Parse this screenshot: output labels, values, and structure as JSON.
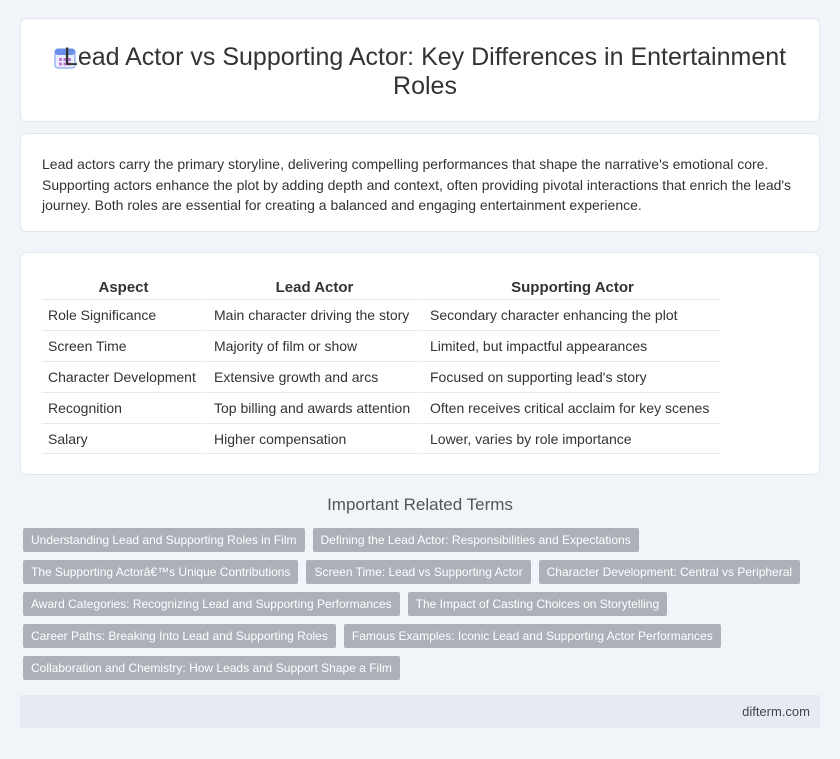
{
  "header": {
    "title": "Lead Actor vs Supporting Actor: Key Differences in Entertainment Roles",
    "icon": "calendar-icon"
  },
  "intro": {
    "text": "Lead actors carry the primary storyline, delivering compelling performances that shape the narrative's emotional core. Supporting actors enhance the plot by adding depth and context, often providing pivotal interactions that enrich the lead's journey. Both roles are essential for creating a balanced and engaging entertainment experience."
  },
  "table": {
    "headers": [
      "Aspect",
      "Lead Actor",
      "Supporting Actor"
    ],
    "rows": [
      [
        "Role Significance",
        "Main character driving the story",
        "Secondary character enhancing the plot"
      ],
      [
        "Screen Time",
        "Majority of film or show",
        "Limited, but impactful appearances"
      ],
      [
        "Character Development",
        "Extensive growth and arcs",
        "Focused on supporting lead's story"
      ],
      [
        "Recognition",
        "Top billing and awards attention",
        "Often receives critical acclaim for key scenes"
      ],
      [
        "Salary",
        "Higher compensation",
        "Lower, varies by role importance"
      ]
    ]
  },
  "related": {
    "heading": "Important Related Terms",
    "tags": [
      "Understanding Lead and Supporting Roles in Film",
      "Defining the Lead Actor: Responsibilities and Expectations",
      "The Supporting Actorâ€™s Unique Contributions",
      "Screen Time: Lead vs Supporting Actor",
      "Character Development: Central vs Peripheral",
      "Award Categories: Recognizing Lead and Supporting Performances",
      "The Impact of Casting Choices on Storytelling",
      "Career Paths: Breaking Into Lead and Supporting Roles",
      "Famous Examples: Iconic Lead and Supporting Actor Performances",
      "Collaboration and Chemistry: How Leads and Support Shape a Film"
    ]
  },
  "footer": {
    "site": "difterm.com"
  },
  "colors": {
    "background": "#f1f4f9",
    "tag_background": "#abb0b9",
    "icon_accent": "#6b8fe8"
  }
}
